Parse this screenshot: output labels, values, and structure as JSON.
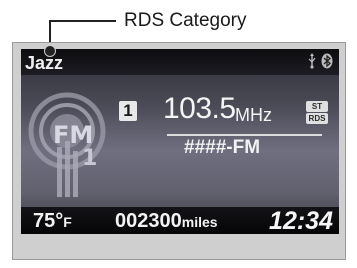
{
  "callout": {
    "label": "RDS Category"
  },
  "display": {
    "category": "Jazz",
    "band_logo": "FM",
    "band_number": "1",
    "preset": "1",
    "frequency": "103.5",
    "frequency_unit": "MHz",
    "stereo_badge": "ST",
    "rds_badge": "RDS",
    "station_name": "####-FM",
    "status_icons": [
      "usb-icon",
      "bluetooth-icon"
    ]
  },
  "bottom": {
    "temperature": "75°",
    "temperature_unit": "F",
    "odometer": "002300",
    "odometer_unit": "miles",
    "clock": "12:34"
  },
  "colors": {
    "screen_top": "#2f2f36",
    "screen_mid": "#6f6f80",
    "bar": "#0d0d10",
    "text": "#f2f2f2",
    "frame": "#cfcfcf"
  }
}
